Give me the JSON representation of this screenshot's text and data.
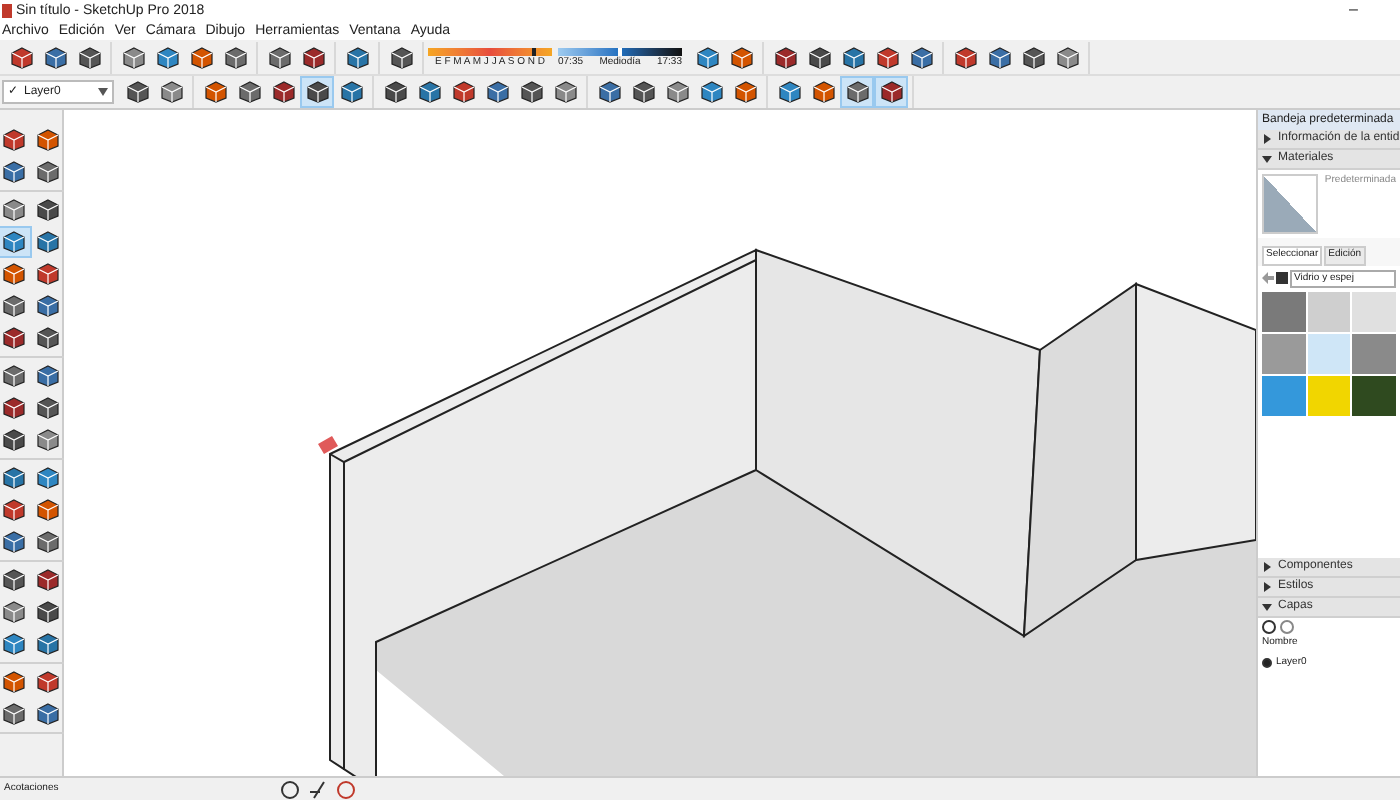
{
  "window": {
    "title": "Sin título - SketchUp Pro 2018",
    "minimize": "–"
  },
  "menu": [
    "Archivo",
    "Edición",
    "Ver",
    "Cámara",
    "Dibujo",
    "Herramientas",
    "Ventana",
    "Ayuda"
  ],
  "toolbar_1": {
    "groups": [
      [
        {
          "selected": false
        },
        {
          "selected": false
        },
        {
          "selected": false
        }
      ],
      [
        {
          "selected": false
        },
        {
          "selected": false
        },
        {
          "selected": false
        },
        {
          "selected": false
        }
      ],
      [
        {
          "selected": false
        },
        {
          "selected": false
        }
      ],
      [
        {
          "selected": false
        }
      ],
      [
        {
          "selected": false
        }
      ]
    ],
    "shadow": {
      "months": "E F M A M J J A S O N D",
      "month_slider": {
        "level": 0.85
      },
      "time_start": "07:35",
      "time_mid": "Mediodía",
      "time_end": "17:33",
      "time_slider": {
        "level": 0.5
      }
    },
    "groups_after": [
      [
        {
          "selected": false
        },
        {
          "selected": false
        }
      ],
      [
        {
          "selected": false
        },
        {
          "selected": false
        },
        {
          "selected": false
        },
        {
          "selected": false
        },
        {
          "selected": false
        }
      ],
      [
        {
          "selected": false
        },
        {
          "selected": false
        },
        {
          "selected": false
        },
        {
          "selected": false
        }
      ]
    ]
  },
  "toolbar_2": {
    "layer": {
      "check": "✓",
      "value": "Layer0"
    },
    "groups": [
      [
        {
          "selected": false
        },
        {
          "selected": false
        }
      ],
      [
        {
          "selected": false
        },
        {
          "selected": false
        },
        {
          "selected": false
        },
        {
          "selected": true
        },
        {
          "selected": false
        }
      ],
      [
        {
          "selected": false
        },
        {
          "selected": false
        },
        {
          "selected": false
        },
        {
          "selected": false
        },
        {
          "selected": false
        },
        {
          "selected": false
        }
      ],
      [
        {
          "selected": false
        },
        {
          "selected": false
        },
        {
          "selected": false
        },
        {
          "selected": false
        },
        {
          "selected": false
        }
      ],
      [
        {
          "selected": false
        },
        {
          "selected": false
        },
        {
          "selected": true
        },
        {
          "selected": true
        }
      ]
    ]
  },
  "tool_palette": [
    [
      [
        {
          "selected": false
        },
        {
          "selected": false
        }
      ],
      [
        {
          "selected": false
        },
        {
          "selected": false
        }
      ]
    ],
    [
      [
        {
          "selected": false
        },
        {
          "selected": false
        }
      ],
      [
        {
          "selected": true
        },
        {
          "selected": false
        }
      ],
      [
        {
          "selected": false
        },
        {
          "selected": false
        }
      ],
      [
        {
          "selected": false
        },
        {
          "selected": false
        }
      ],
      [
        {
          "selected": false
        },
        {
          "selected": false
        }
      ]
    ],
    [
      [
        {
          "selected": false
        },
        {
          "selected": false
        }
      ],
      [
        {
          "selected": false
        },
        {
          "selected": false
        }
      ],
      [
        {
          "selected": false
        },
        {
          "selected": false
        }
      ]
    ],
    [
      [
        {
          "selected": false
        },
        {
          "selected": false
        }
      ],
      [
        {
          "selected": false
        },
        {
          "selected": false
        }
      ],
      [
        {
          "selected": false
        },
        {
          "selected": false
        }
      ]
    ],
    [
      [
        {
          "selected": false
        },
        {
          "selected": false
        }
      ],
      [
        {
          "selected": false
        },
        {
          "selected": false
        }
      ],
      [
        {
          "selected": false
        },
        {
          "selected": false
        }
      ]
    ],
    [
      [
        {
          "selected": false
        },
        {
          "selected": false
        }
      ],
      [
        {
          "selected": false
        },
        {
          "selected": false
        }
      ]
    ]
  ],
  "tray": {
    "title": "Bandeja predeterminada",
    "sections_top": [
      {
        "label": "Información de la entid",
        "expanded": false
      },
      {
        "label": "Materiales",
        "expanded": true
      }
    ],
    "materials": {
      "name": "Predeterminada",
      "tabs": [
        {
          "label": "Seleccionar",
          "selected": true
        },
        {
          "label": "Edición",
          "selected": false
        }
      ],
      "library": "Vidrio y espej"
    },
    "sections_bottom": [
      {
        "label": "Componentes",
        "expanded": false
      },
      {
        "label": "Estilos",
        "expanded": false
      },
      {
        "label": "Capas",
        "expanded": true
      }
    ],
    "layers": {
      "column": "Nombre",
      "rows": [
        {
          "name": "Layer0",
          "selected": true
        }
      ]
    }
  },
  "status_bar": {
    "label": "Acotaciones"
  }
}
